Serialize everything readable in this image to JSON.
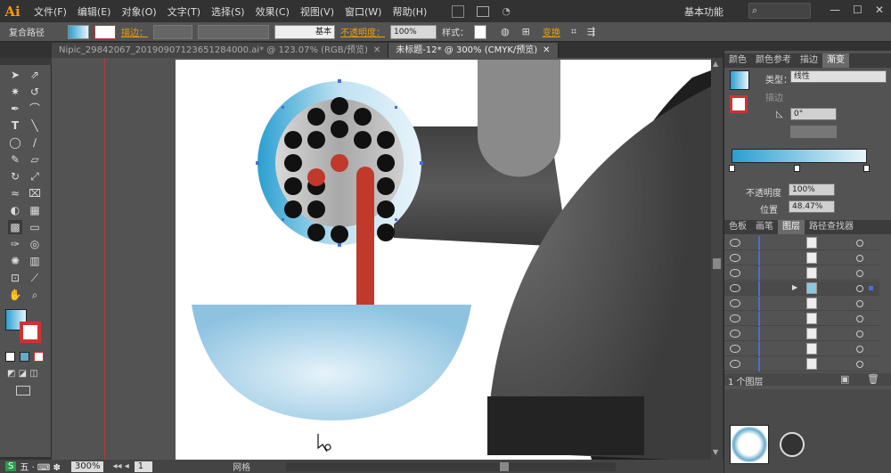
{
  "app": {
    "logo": "Ai",
    "workspace": "基本功能"
  },
  "menu": [
    "文件(F)",
    "编辑(E)",
    "对象(O)",
    "文字(T)",
    "选择(S)",
    "效果(C)",
    "视图(V)",
    "窗口(W)",
    "帮助(H)"
  ],
  "controlbar": {
    "object_type": "复合路径",
    "stroke_label": "描边：",
    "stroke_style": "基本",
    "opacity_label": "不透明度：",
    "opacity_value": "100%",
    "style_label": "样式：",
    "transform_label": "变换"
  },
  "tabs": [
    {
      "label": "Nipic_29842067_20190907123651284000.ai* @ 123.07% (RGB/预览)"
    },
    {
      "label": "未标题-12* @ 300% (CMYK/预览)",
      "active": true
    }
  ],
  "status": {
    "zoom": "300%",
    "page": "1",
    "tool_name": "网格"
  },
  "panel": {
    "tabs_top": [
      "颜色",
      "颜色参考",
      "描边",
      "渐变"
    ],
    "gradient": {
      "type_label": "类型：",
      "type_value": "线性",
      "stroke_label": "描边",
      "angle_value": "0°",
      "opacity_label": "不透明度",
      "opacity_value": "100%",
      "location_label": "位置",
      "location_value": "48.47%"
    },
    "tabs_mid": [
      "色板",
      "画笔",
      "图层",
      "路径查找器"
    ],
    "layers_count": "1 个图层"
  },
  "colors": {
    "accent_orange": "#f0a000",
    "guide_red": "#b43c3c",
    "layer_blue": "#4a6fd0"
  }
}
